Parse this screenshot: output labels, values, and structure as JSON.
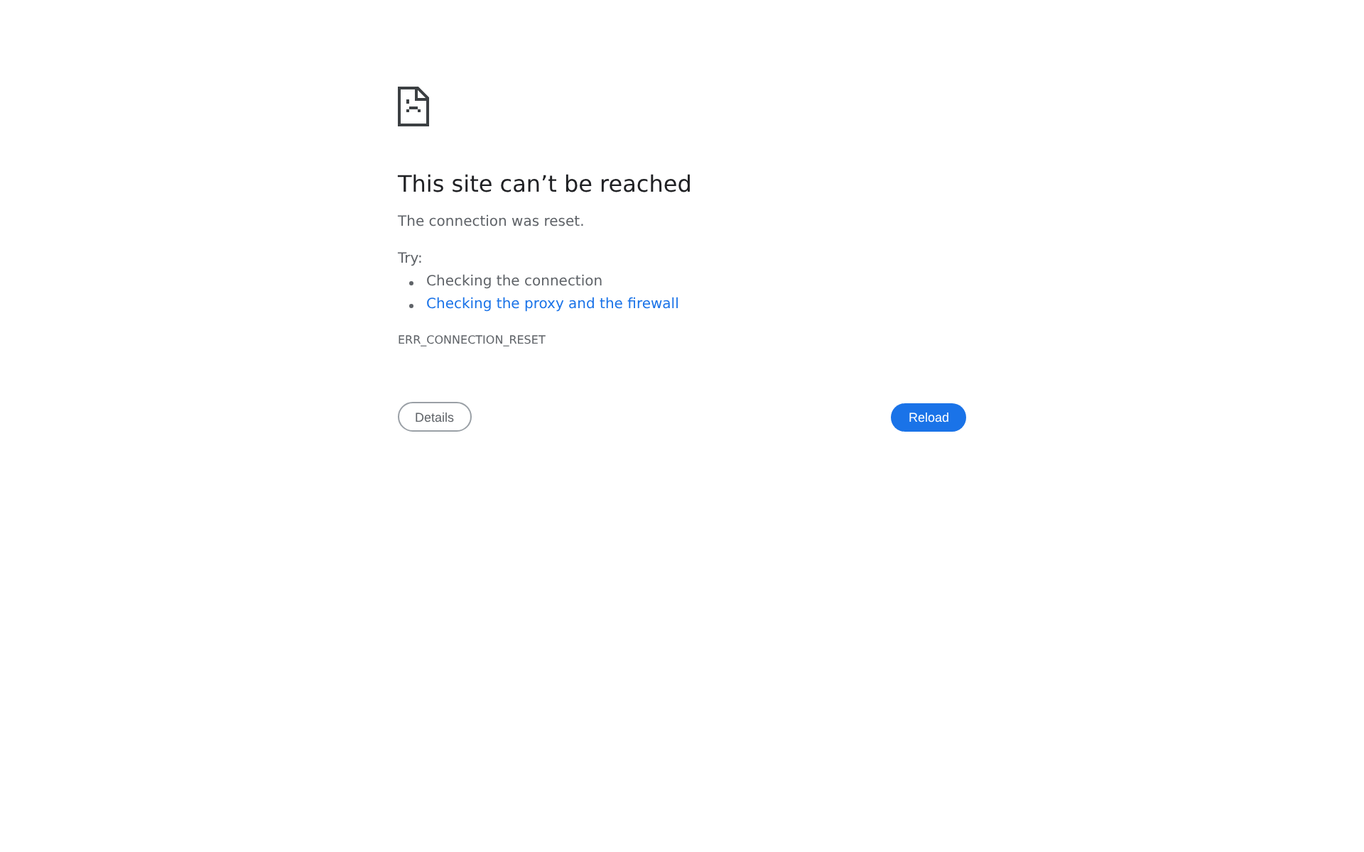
{
  "heading": "This site can’t be reached",
  "message": "The connection was reset.",
  "suggestions": {
    "label": "Try:",
    "items": [
      {
        "kind": "text",
        "text": "Checking the connection"
      },
      {
        "kind": "link",
        "text": "Checking the proxy and the firewall"
      }
    ]
  },
  "error_code": "ERR_CONNECTION_RESET",
  "buttons": {
    "details": "Details",
    "reload": "Reload"
  }
}
